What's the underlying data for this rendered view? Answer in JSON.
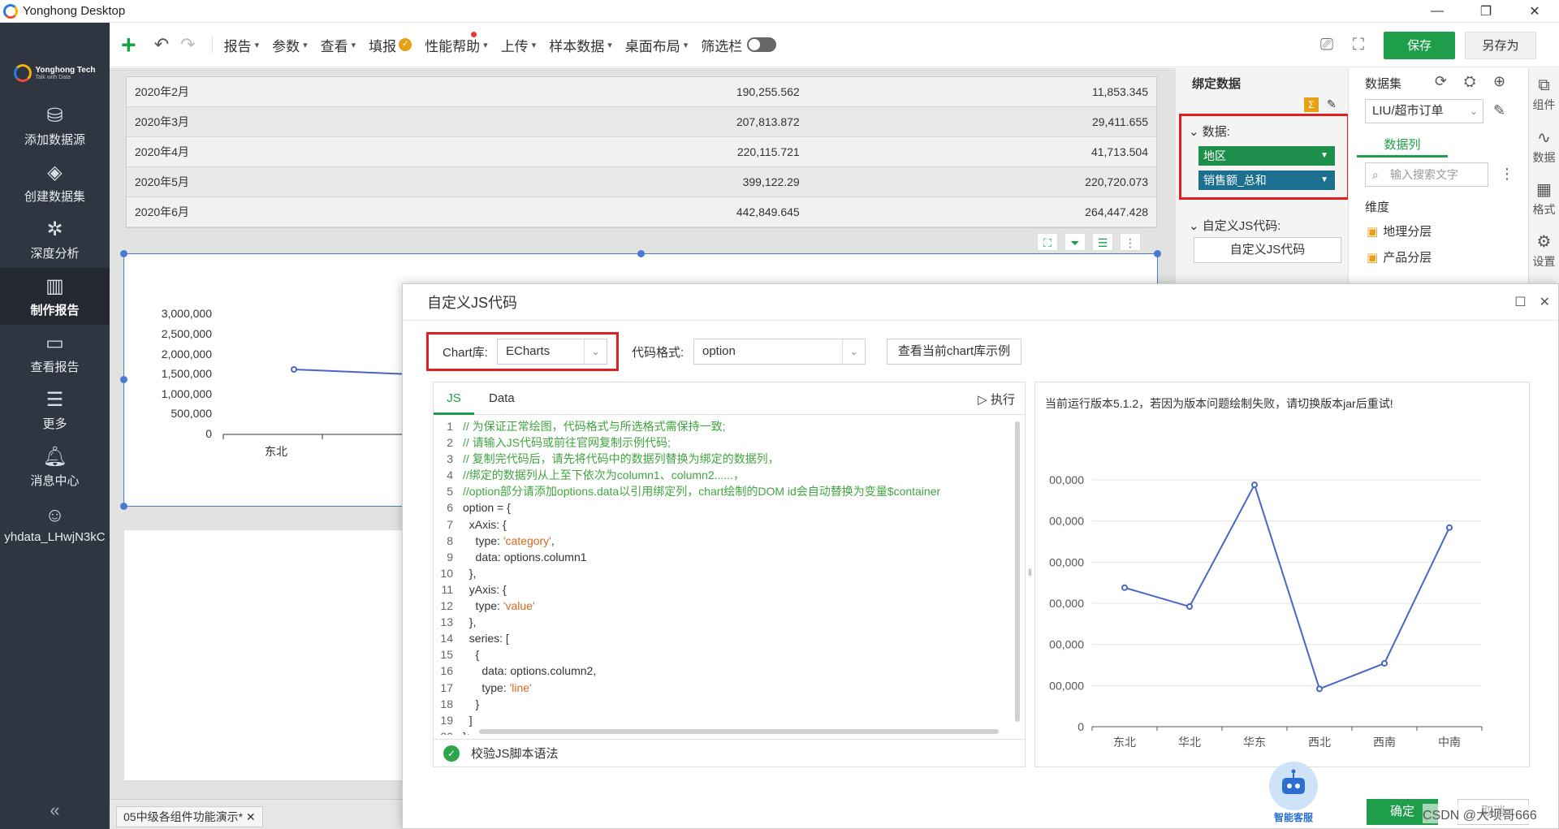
{
  "window": {
    "title": "Yonghong Desktop",
    "controls": [
      "—",
      "❐",
      "✕"
    ]
  },
  "sidebar": {
    "brand": "Yonghong Tech",
    "brand_sub": "Talk with Data",
    "items": [
      {
        "label": "添加数据源",
        "icon": "database-icon"
      },
      {
        "label": "创建数据集",
        "icon": "layers-icon"
      },
      {
        "label": "深度分析",
        "icon": "network-icon"
      },
      {
        "label": "制作报告",
        "icon": "report-chart-icon",
        "active": true
      },
      {
        "label": "查看报告",
        "icon": "monitor-chart-icon"
      },
      {
        "label": "更多",
        "icon": "menu-icon"
      },
      {
        "label": "消息中心",
        "icon": "bell-icon"
      },
      {
        "label": "yhdata_LHwjN3kC",
        "icon": "user-icon"
      }
    ],
    "collapse": "«"
  },
  "toolbar": {
    "add": "+",
    "menus": [
      "报告",
      "参数",
      "查看",
      "填报",
      "性能帮助",
      "上传",
      "样本数据",
      "桌面布局",
      "筛选栏"
    ],
    "save": "保存",
    "save_as": "另存为"
  },
  "table": {
    "rows": [
      {
        "month": "2020年2月",
        "v1": "190,255.562",
        "v2": "11,853.345"
      },
      {
        "month": "2020年3月",
        "v1": "207,813.872",
        "v2": "29,411.655"
      },
      {
        "month": "2020年4月",
        "v1": "220,115.721",
        "v2": "41,713.504"
      },
      {
        "month": "2020年5月",
        "v1": "399,122.29",
        "v2": "220,720.073"
      },
      {
        "month": "2020年6月",
        "v1": "442,849.645",
        "v2": "264,447.428"
      }
    ]
  },
  "bg_chart": {
    "yticks": [
      "3,000,000",
      "2,500,000",
      "2,000,000",
      "1,500,000",
      "1,000,000",
      "500,000",
      "0"
    ],
    "xfirst": "东北"
  },
  "bind_panel": {
    "title": "绑定数据",
    "data_label": "数据:",
    "fields": [
      "地区",
      "销售额_总和"
    ],
    "js_label": "自定义JS代码:",
    "js_button": "自定义JS代码"
  },
  "dataset_panel": {
    "title": "数据集",
    "dataset": "LIU/超市订单",
    "tab": "数据列",
    "search_placeholder": "输入搜索文字",
    "dim_label": "维度",
    "items": [
      "地理分层",
      "产品分层"
    ]
  },
  "vtabs": [
    {
      "label": "组件",
      "icon": "component-icon"
    },
    {
      "label": "数据",
      "icon": "data-icon"
    },
    {
      "label": "格式",
      "icon": "grid-icon"
    },
    {
      "label": "设置",
      "icon": "gear-icon"
    }
  ],
  "bottom_tab": "05中级各组件功能演示*",
  "dialog": {
    "title": "自定义JS代码",
    "chartlib_label": "Chart库:",
    "chartlib_value": "ECharts",
    "format_label": "代码格式:",
    "format_value": "option",
    "example_button": "查看当前chart库示例",
    "tabs": [
      "JS",
      "Data"
    ],
    "run": "执行",
    "validate": "校验JS脚本语法",
    "preview_note": "当前运行版本5.1.2，若因为版本问题绘制失败，请切换版本jar后重试!",
    "ok": "确定",
    "cancel": "取消",
    "bot_label": "智能客服",
    "code": [
      "// 为保证正常绘图，代码格式与所选格式需保持一致;",
      "// 请输入JS代码或前往官网复制示例代码;",
      "// 复制完代码后，请先将代码中的数据列替换为绑定的数据列，",
      "//绑定的数据列从上至下依次为column1、column2......，",
      "//option部分请添加options.data以引用绑定列，chart绘制的DOM id会自动替换为变量$container",
      "option = {",
      "  xAxis: {",
      "    type: 'category',",
      "    data: options.column1",
      "  },",
      "  yAxis: {",
      "    type: 'value'",
      "  },",
      "  series: [",
      "    {",
      "      data: options.column2,",
      "      type: 'line'",
      "    }",
      "  ]",
      "};"
    ]
  },
  "chart_data": {
    "type": "line",
    "categories": [
      "东北",
      "华北",
      "华东",
      "西北",
      "西南",
      "中南"
    ],
    "y_tick_labels": [
      "00,000",
      "00,000",
      "00,000",
      "00,000",
      "00,000",
      "00,000",
      "0"
    ],
    "values": [
      1690000,
      1460000,
      2940000,
      460000,
      770000,
      2420000
    ],
    "ylim": [
      0,
      3000000
    ]
  },
  "watermark": "CSDN @大坝哥666"
}
